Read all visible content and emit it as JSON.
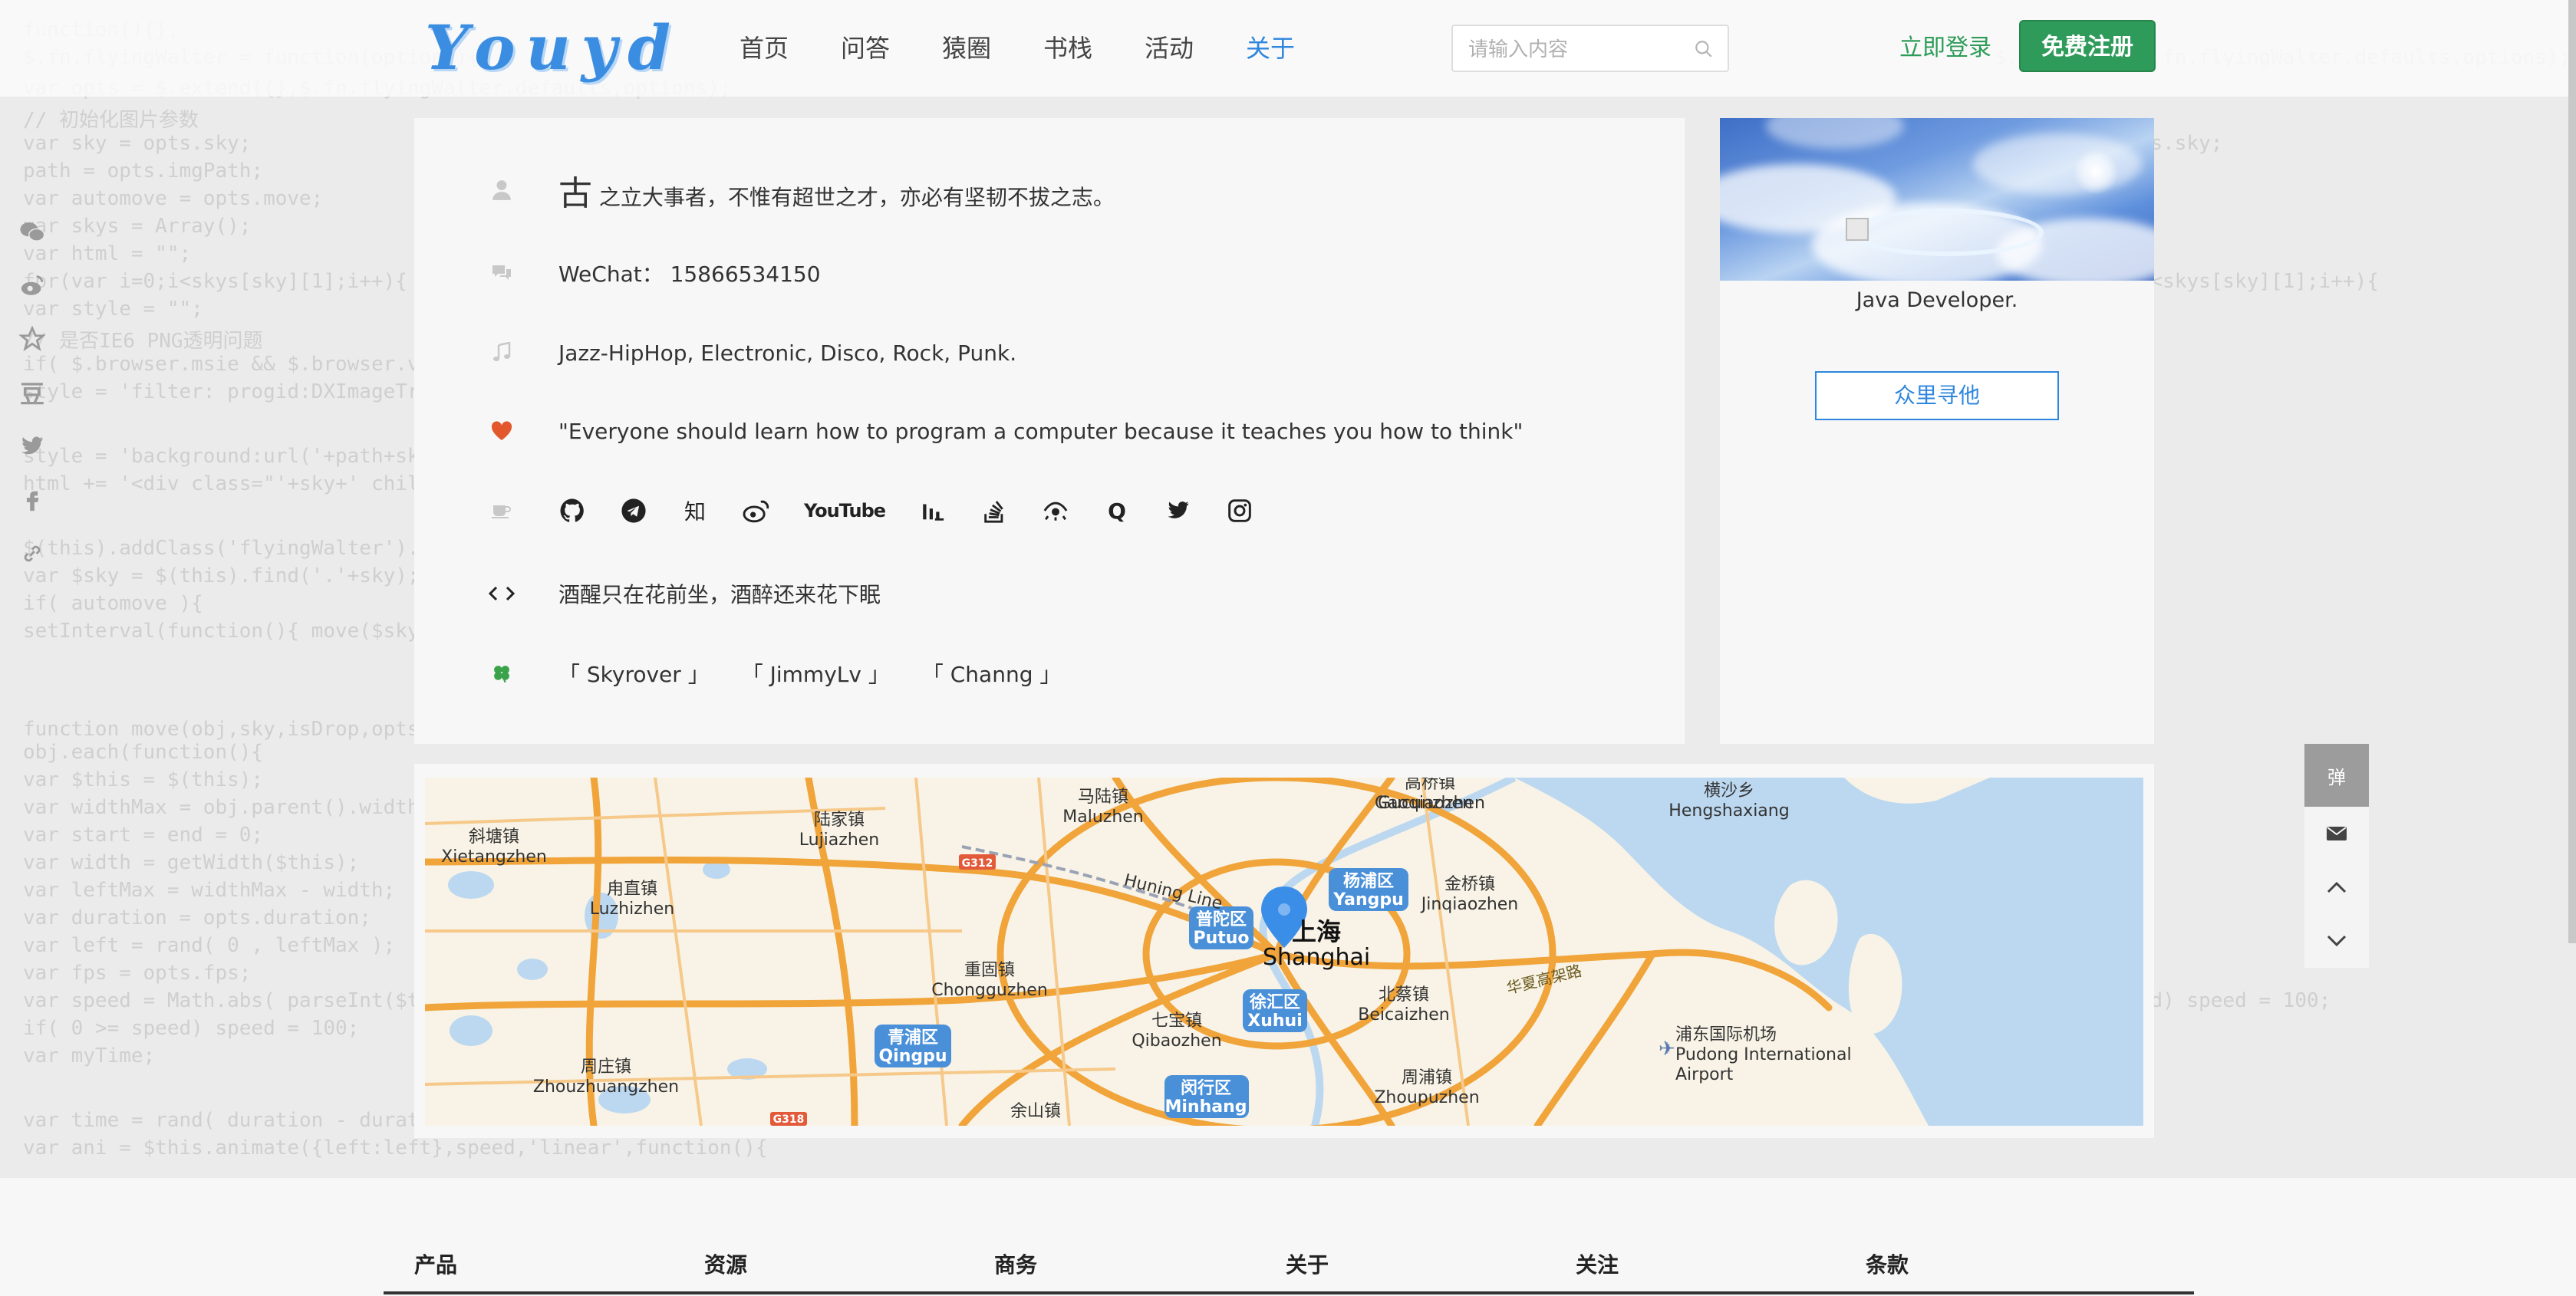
{
  "header": {
    "logo": "Youyd",
    "nav": [
      "首页",
      "问答",
      "猿圈",
      "书栈",
      "活动",
      "关于"
    ],
    "active_nav": "关于",
    "search_placeholder": "请输入内容",
    "login": "立即登录",
    "register": "免费注册"
  },
  "left_bar": {
    "items": [
      "wechat-icon",
      "weibo-icon",
      "star-icon",
      "douban-icon",
      "twitter-icon",
      "facebook-icon",
      "link-icon"
    ],
    "douban_text": "豆"
  },
  "about": {
    "motto_big": "古",
    "motto_rest": "之立大事者，不惟有超世之才，亦必有坚韧不拔之志。",
    "wechat": "WeChat： 15866534150",
    "music": "Jazz-HipHop, Electronic, Disco, Rock, Punk.",
    "quote": "\"Everyone should learn how to program a computer because it teaches you how to think\"",
    "social_links": [
      "github-icon",
      "telegram-icon",
      "zhihu-icon",
      "weibo-icon",
      "youtube-icon",
      "bilibili-icon",
      "stackoverflow-icon",
      "eye-icon",
      "quora-icon",
      "twitter-icon",
      "instagram-icon"
    ],
    "zhihu_text": "知",
    "youtube_text": "YouTube",
    "quora_text": "Q",
    "poem": "酒醒只在花前坐，酒醉还来花下眠",
    "friends": [
      "「 Skyrover 」",
      "「 JimmyLv 」",
      "「 Channg 」"
    ],
    "accent_heart": "#e2572b",
    "accent_clover": "#3aa34a"
  },
  "profile": {
    "role": "Java Developer.",
    "follow": "众里寻他"
  },
  "map": {
    "labels": [
      {
        "zh": "马陆镇",
        "en": "Maluzhen"
      },
      {
        "zh": "高桥镇",
        "en": "Gaoqiaozhen"
      },
      {
        "zh": "横沙乡",
        "en": "Hengshaxiang"
      },
      {
        "zh": "陆家镇",
        "en": "Lujiazhen"
      },
      {
        "zh": "斜塘镇",
        "en": "Xietangzhen"
      },
      {
        "zh": "甪直镇",
        "en": "Luzhizhen"
      },
      {
        "zh": "金桥镇",
        "en": "Jinqiaozhen"
      },
      {
        "zh": "重固镇",
        "en": "Chongguzhen"
      },
      {
        "zh": "北蔡镇",
        "en": "Beicaizhen"
      },
      {
        "zh": "七宝镇",
        "en": "Qibaozhen"
      },
      {
        "zh": "周庄镇",
        "en": "Zhouzhuangzhen"
      },
      {
        "zh": "周浦镇",
        "en": "Zhoupuzhen"
      },
      {
        "zh": "浦东国际机场",
        "en": "Pudong International"
      },
      {
        "zh": "余山镇",
        "en": ""
      },
      {
        "zh": "",
        "en": "Gucunzhen"
      }
    ],
    "districts": [
      {
        "zh": "普陀区",
        "en": "Putuo"
      },
      {
        "zh": "杨浦区",
        "en": "Yangpu"
      },
      {
        "zh": "徐汇区",
        "en": "Xuhui"
      },
      {
        "zh": "青浦区",
        "en": "Qingpu"
      },
      {
        "zh": "闵行区",
        "en": "Minhang"
      }
    ],
    "city_zh": "上海",
    "city_en": "Shanghai",
    "airport_line2": "Airport",
    "road_huning": "Huning Line",
    "road_huaxia": "华夏高架路",
    "road_g312": "G312",
    "road_g318": "G318",
    "water_color": "#bcd8f0",
    "land_color": "#f8f3e6",
    "road_color": "#f0a43a",
    "marker_color": "#3b8ee8"
  },
  "tools": {
    "danmu": "弹"
  },
  "footer": {
    "columns": [
      "产品",
      "资源",
      "商务",
      "关于",
      "关注",
      "条款"
    ]
  }
}
